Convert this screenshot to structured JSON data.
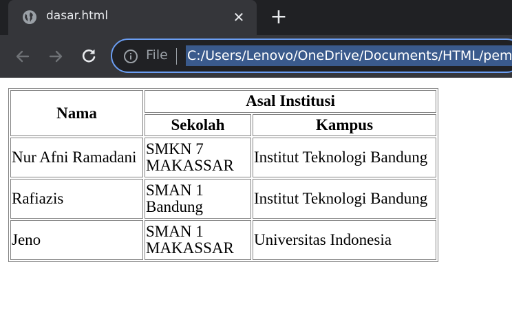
{
  "tab": {
    "title": "dasar.html",
    "icon": "globe-icon",
    "close_icon": "close-icon"
  },
  "new_tab_icon": "plus-icon",
  "toolbar": {
    "back_icon": "arrow-left-icon",
    "forward_icon": "arrow-right-icon",
    "reload_icon": "reload-icon"
  },
  "address_bar": {
    "info_icon": "info-icon",
    "scheme": "File",
    "url": "C:/Users/Lenovo/OneDrive/Documents/HTML/pem"
  },
  "table": {
    "header": {
      "nama": "Nama",
      "asal_institusi": "Asal Institusi",
      "sekolah": "Sekolah",
      "kampus": "Kampus"
    },
    "rows": [
      {
        "nama": "Nur Afni Ramadani",
        "sekolah_line1": "SMKN 7",
        "sekolah_line2": "MAKASSAR",
        "kampus": "Institut Teknologi Bandung"
      },
      {
        "nama": "Rafiazis",
        "sekolah_line1": "SMAN 1",
        "sekolah_line2": "Bandung",
        "kampus": "Institut Teknologi Bandung"
      },
      {
        "nama": "Jeno",
        "sekolah_line1": "SMAN 1",
        "sekolah_line2": "MAKASSAR",
        "kampus": "Universitas Indonesia"
      }
    ]
  },
  "colors": {
    "titlebar": "#202124",
    "toolbar": "#35363a",
    "omnibox_border": "#6b9ef3",
    "url_highlight": "#3a5a8c"
  }
}
